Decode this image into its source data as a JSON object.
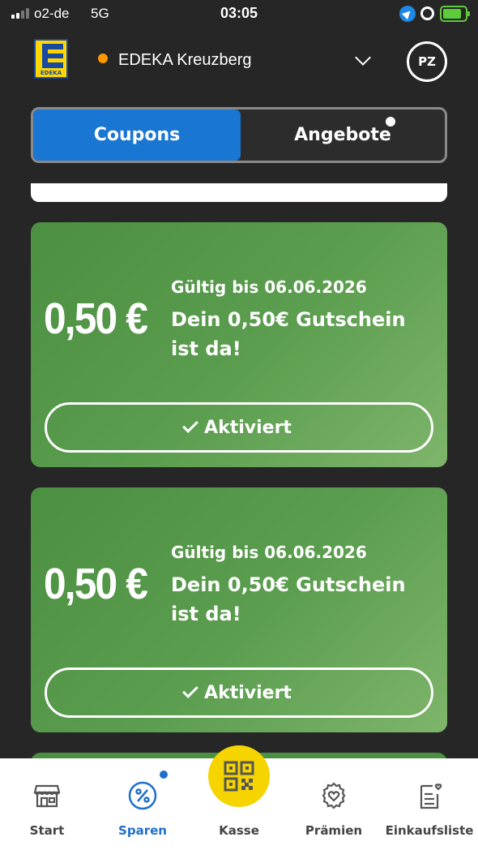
{
  "status_bar": {
    "carrier": "o2-de",
    "network": "5G",
    "time": "03:05"
  },
  "header": {
    "logo_text": "EDEKA",
    "store_name": "EDEKA Kreuzberg",
    "avatar_initials": "PZ",
    "store_status_color": "#ff9800"
  },
  "tabs": {
    "coupons_label": "Coupons",
    "angebote_label": "Angebote",
    "active": "Coupons"
  },
  "coupons": [
    {
      "value": "0,50 €",
      "valid_until": "Gültig bis 06.06.2026",
      "title": "Dein 0,50€ Gutschein ist da!",
      "button_label": "Aktiviert"
    },
    {
      "value": "0,50 €",
      "valid_until": "Gültig bis 06.06.2026",
      "title": "Dein 0,50€ Gutschein ist da!",
      "button_label": "Aktiviert"
    }
  ],
  "bottom_nav": {
    "items": [
      {
        "label": "Start",
        "icon": "store-icon"
      },
      {
        "label": "Sparen",
        "icon": "percent-icon",
        "active": true
      },
      {
        "label": "Kasse",
        "icon": "qr-code-icon"
      },
      {
        "label": "Prämien",
        "icon": "heart-badge-icon"
      },
      {
        "label": "Einkaufsliste",
        "icon": "shopping-list-icon"
      }
    ]
  },
  "colors": {
    "accent_blue": "#1976d2",
    "coupon_green": "#5c9e4f",
    "kasse_yellow": "#f5d400",
    "logo_yellow": "#ffd600"
  }
}
